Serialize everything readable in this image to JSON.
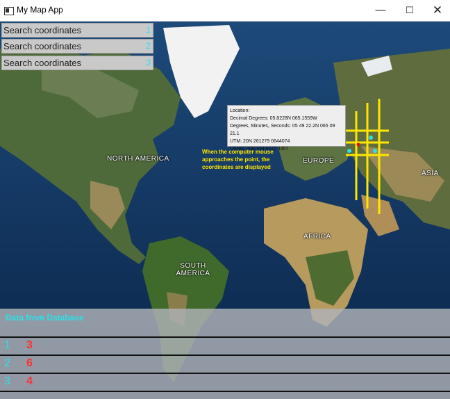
{
  "window": {
    "title": "My Map App",
    "controls": {
      "minimize": "—",
      "maximize": "☐",
      "close": "✕"
    }
  },
  "search_boxes": [
    {
      "placeholder": "Search coordinates",
      "number": "1"
    },
    {
      "placeholder": "Search coordinates",
      "number": "2"
    },
    {
      "placeholder": "Search coordinates",
      "number": "3"
    }
  ],
  "map": {
    "labels": [
      "NORTH AMERICA",
      "EUROPE",
      "ASIA",
      "AFRICA",
      "SOUTH AMERICA"
    ],
    "tooltip": {
      "heading": "Location:",
      "decimal": "Decimal Degrees: 05.8228N 065.1559W",
      "dms": "Degrees, Minutes, Seconds: 05 49 22.2N 065 09 21.1",
      "utm": "UTM: 20N 261279 0644074",
      "usng": "USNG: 20N KM 6127 4407"
    },
    "annotation": "When the computer mouse approaches the point, the coordinates are displayed",
    "grid_color": "#ffe600",
    "point_color": "#2de0e6"
  },
  "database_panel": {
    "title": "Data from Database",
    "rows": [
      {
        "index": "1",
        "value": "3"
      },
      {
        "index": "2",
        "value": "6"
      },
      {
        "index": "3",
        "value": "4"
      }
    ]
  }
}
